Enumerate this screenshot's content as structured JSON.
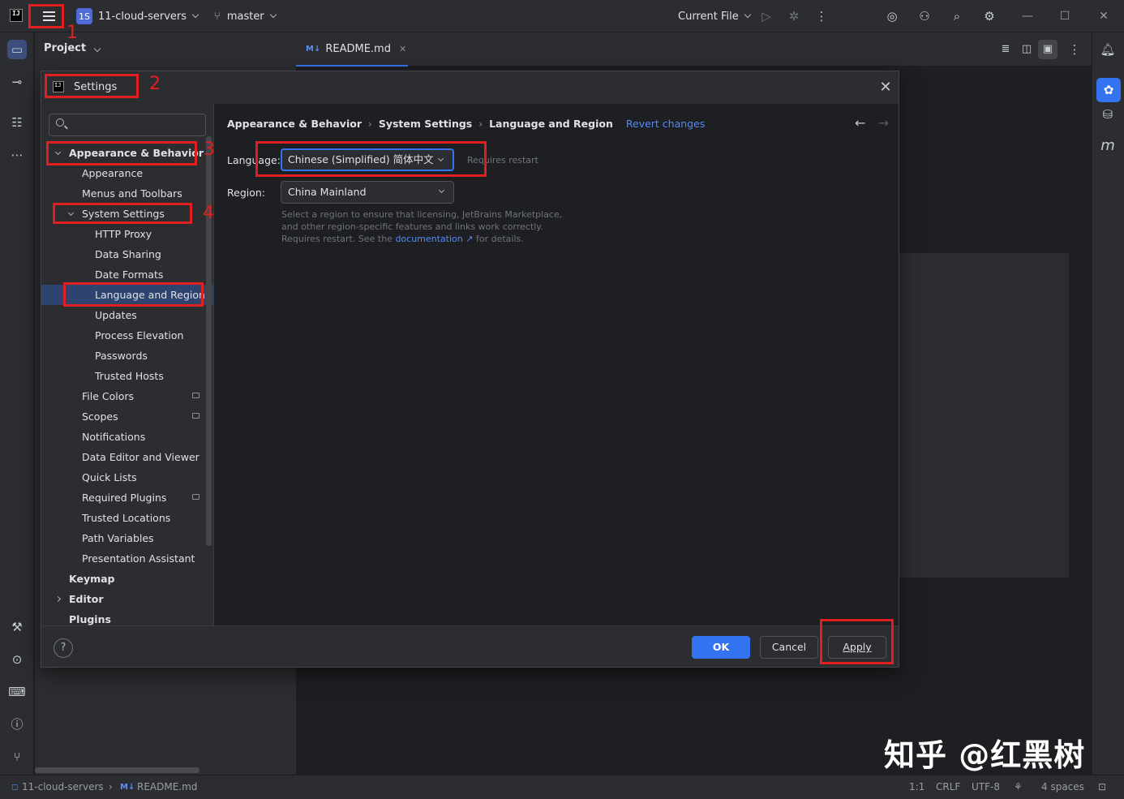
{
  "titlebar": {
    "project_initials": "1S",
    "project_name": "11-cloud-servers",
    "branch_name": "master",
    "run_config": "Current File"
  },
  "project_panel": {
    "title": "Project"
  },
  "editor": {
    "tab_icon": "M↓",
    "tab_label": "README.md"
  },
  "dialog": {
    "title": "Settings",
    "search_placeholder": "",
    "breadcrumb": [
      "Appearance & Behavior",
      "System Settings",
      "Language and Region"
    ],
    "revert_label": "Revert changes",
    "language_label": "Language:",
    "language_value": "Chinese (Simplified) 简体中文",
    "requires_restart": "Requires restart",
    "region_label": "Region:",
    "region_value": "China Mainland",
    "region_desc_1": "Select a region to ensure that licensing, JetBrains Marketplace, and other region-specific features and links work correctly. Requires restart. See the ",
    "region_desc_link": "documentation ↗",
    "region_desc_2": " for details.",
    "help_label": "?",
    "ok_label": "OK",
    "cancel_label": "Cancel",
    "apply_label": "Apply"
  },
  "tree": [
    {
      "label": "Appearance & Behavior",
      "level": 0,
      "bold": true,
      "arrow": "down"
    },
    {
      "label": "Appearance",
      "level": 1
    },
    {
      "label": "Menus and Toolbars",
      "level": 1
    },
    {
      "label": "System Settings",
      "level": 1,
      "arrow": "down"
    },
    {
      "label": "HTTP Proxy",
      "level": 2
    },
    {
      "label": "Data Sharing",
      "level": 2
    },
    {
      "label": "Date Formats",
      "level": 2
    },
    {
      "label": "Language and Region",
      "level": 2,
      "selected": true
    },
    {
      "label": "Updates",
      "level": 2
    },
    {
      "label": "Process Elevation",
      "level": 2
    },
    {
      "label": "Passwords",
      "level": 2
    },
    {
      "label": "Trusted Hosts",
      "level": 2
    },
    {
      "label": "File Colors",
      "level": 1,
      "badge": true
    },
    {
      "label": "Scopes",
      "level": 1,
      "badge": true
    },
    {
      "label": "Notifications",
      "level": 1
    },
    {
      "label": "Data Editor and Viewer",
      "level": 1
    },
    {
      "label": "Quick Lists",
      "level": 1
    },
    {
      "label": "Required Plugins",
      "level": 1,
      "badge": true
    },
    {
      "label": "Trusted Locations",
      "level": 1
    },
    {
      "label": "Path Variables",
      "level": 1
    },
    {
      "label": "Presentation Assistant",
      "level": 1
    },
    {
      "label": "Keymap",
      "level": 0,
      "bold": true
    },
    {
      "label": "Editor",
      "level": 0,
      "bold": true,
      "arrow": "right"
    },
    {
      "label": "Plugins",
      "level": 0,
      "bold": true
    }
  ],
  "annotations": [
    "1",
    "2",
    "3",
    "4"
  ],
  "statusbar": {
    "project": "11-cloud-servers",
    "file_icon": "M↓",
    "file": "README.md",
    "position": "1:1",
    "line_sep": "CRLF",
    "encoding": "UTF-8",
    "indent": "4 spaces"
  },
  "watermark": "知乎 @红黑树",
  "colors": {
    "accent": "#3574f0",
    "annotation": "#e02020",
    "link": "#548af7"
  }
}
